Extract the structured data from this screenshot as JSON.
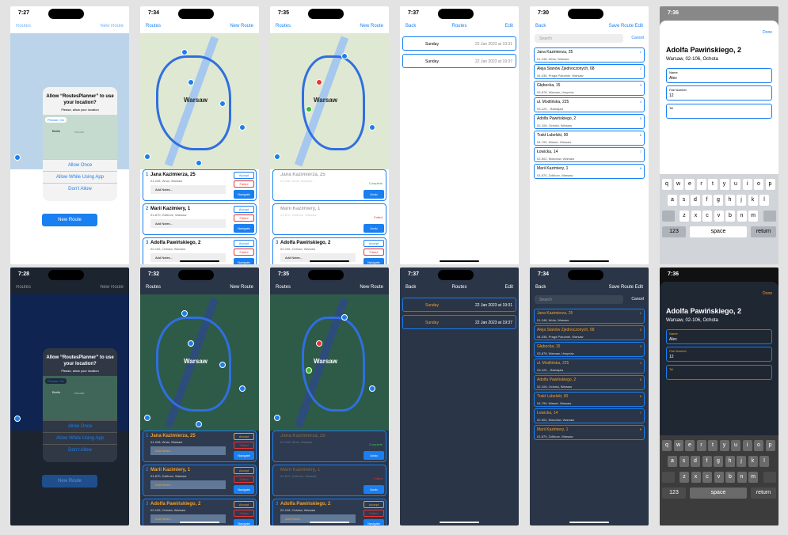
{
  "shared": {
    "routes": "Routes",
    "new_route": "New Route",
    "back": "Back",
    "edit": "Edit",
    "save_route": "Save Route",
    "done": "Done",
    "cancel": "Cancel",
    "search": "Search",
    "city": "Warsaw",
    "signal": "..."
  },
  "times": [
    "7:27",
    "7:34",
    "7:35",
    "7:37",
    "7:30",
    "7:36",
    "7:28",
    "7:32",
    "7:35",
    "7:37",
    "7:34",
    "7:36"
  ],
  "alert": {
    "title": "Allow “RoutesPlanner” to use your location?",
    "subtitle": "Please, allow your location",
    "precise": "Precise: On",
    "once": "Allow Once",
    "while": "Allow While Using App",
    "dont": "Don’t Allow",
    "map_city1": "Berlin",
    "map_city2": "POLAND"
  },
  "cards": [
    {
      "num": "1",
      "name": "Jana Kazimierza, 25",
      "addr": "01-248, Wola, Warsaw",
      "notes": "Add Notes..."
    },
    {
      "num": "2",
      "name": "Marii Kazimiery, 1",
      "addr": "01-870, Żoliborz, Warsaw",
      "notes": "Add Notes..."
    },
    {
      "num": "3",
      "name": "Adolfa Pawińskiego, 2",
      "addr": "02-106, Ochota, Warsaw",
      "notes": "Add Notes..."
    }
  ],
  "card_btns": {
    "accept": "Accept",
    "failed": "Failed",
    "navigate": "Navigate",
    "undo": "Undo",
    "complete": "Complete"
  },
  "history": [
    {
      "day": "Sunday",
      "date": "22 Jan 2023 at 19:31"
    },
    {
      "day": "Sunday",
      "date": "22 Jan 2023 at 19:37"
    }
  ],
  "stops": [
    {
      "i": "1",
      "name": "Jana Kazimierza, 25",
      "addr": "01-248, Wola, Warsaw"
    },
    {
      "i": "2",
      "name": "Aleja Stanów Zjednoczonych, 68",
      "addr": "04-036, Praga Południe, Warsaw"
    },
    {
      "i": "3",
      "name": "Głębocka, 15",
      "addr": "03-678, Warsaw, Ursynów"
    },
    {
      "i": "4",
      "name": "ul. Modlińska, 225",
      "addr": "03-120, , Białołęka"
    },
    {
      "i": "5",
      "name": "Adolfa Pawińskiego, 2",
      "addr": "02-106, Ochota, Warsaw"
    },
    {
      "i": "6",
      "name": "Trakt Lubelski, 90",
      "addr": "04-790, Wawer, Warsaw"
    },
    {
      "i": "7",
      "name": "Łowicka, 14",
      "addr": "02-502, Mokotów, Warsaw"
    },
    {
      "i": "8",
      "name": "Marii Kazimiery, 1",
      "addr": "01-870, Żoliborz, Warsaw"
    }
  ],
  "detail": {
    "title": "Adolfa Pawińskiego, 2",
    "subtitle": "Warsaw, 02-106, Ochota",
    "name_label": "Name",
    "name_value": "Alex",
    "phone_label": "Flat Number",
    "phone_value": "12",
    "tel_label": "Tel"
  },
  "keyboard": {
    "row1": [
      "q",
      "w",
      "e",
      "r",
      "t",
      "y",
      "u",
      "i",
      "o",
      "p"
    ],
    "row2": [
      "a",
      "s",
      "d",
      "f",
      "g",
      "h",
      "j",
      "k",
      "l"
    ],
    "row3": [
      "z",
      "x",
      "c",
      "v",
      "b",
      "n",
      "m"
    ],
    "num": "123",
    "space": "space",
    "ret": "return"
  }
}
